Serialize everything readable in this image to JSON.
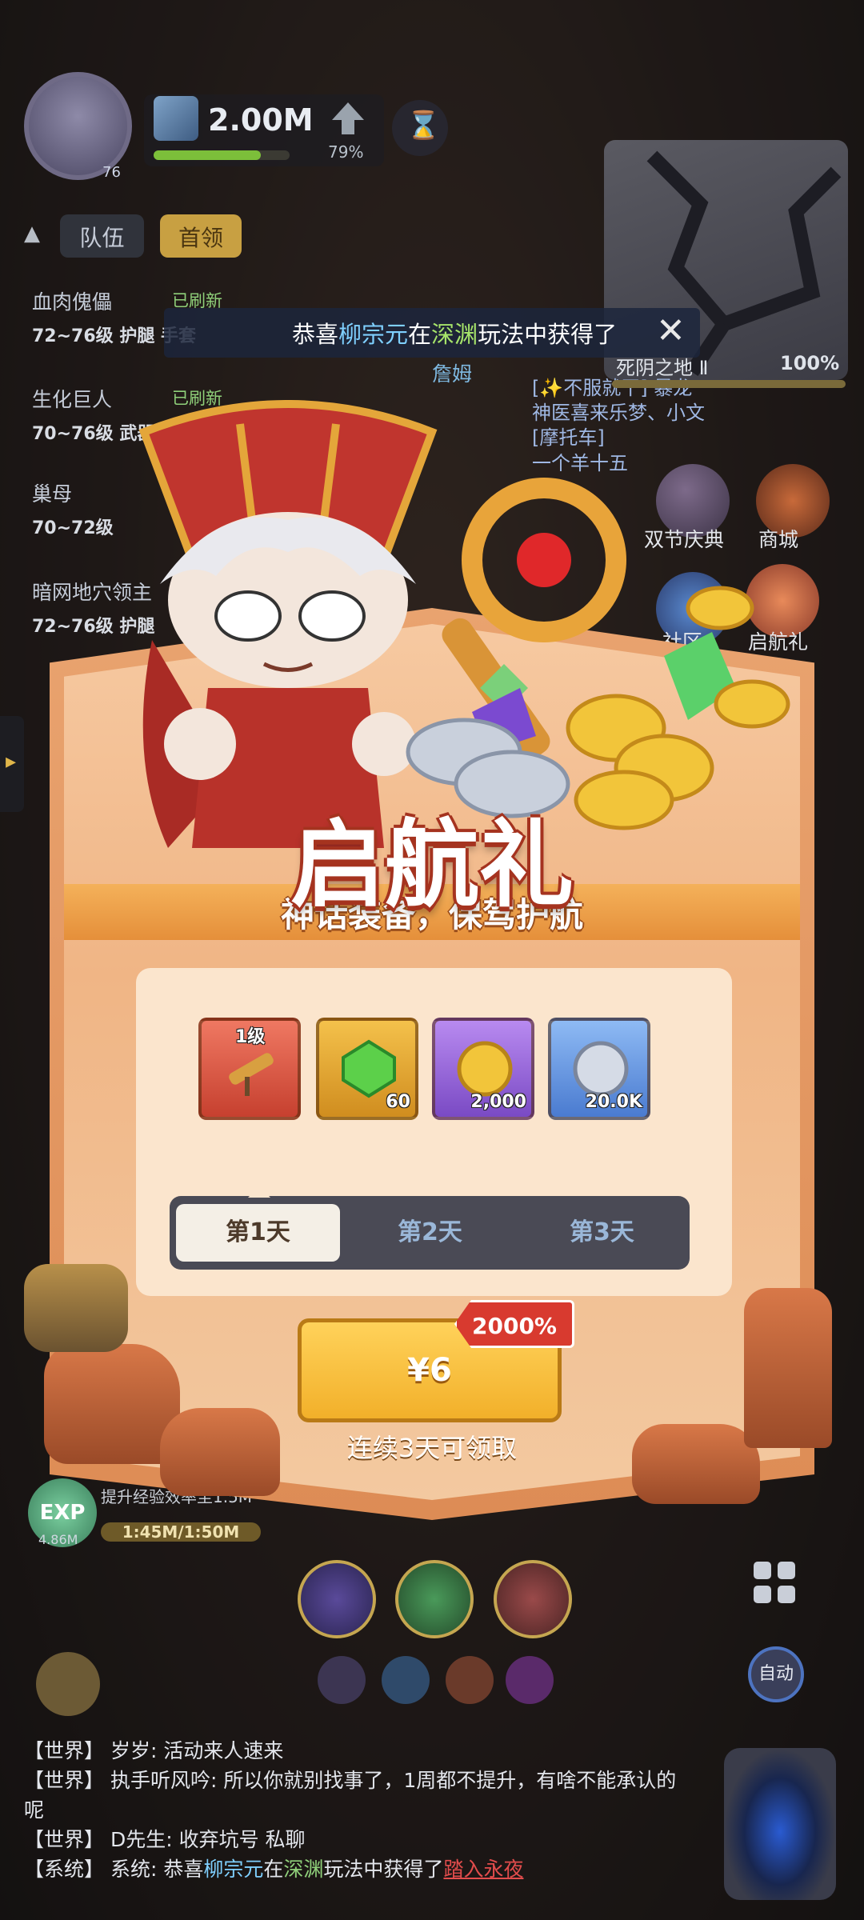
{
  "hud": {
    "power": "2.00M",
    "power_progress_pct": 79,
    "power_progress_label": "79%",
    "avatar_level": "76"
  },
  "minimap": {
    "zone_name": "死阴之地 Ⅱ",
    "progress": "100%"
  },
  "tabs": {
    "team": "队伍",
    "boss": "首领"
  },
  "bosses": [
    {
      "name": "血肉傀儡",
      "status": "已刷新",
      "detail": "72~76级  护腿  手套"
    },
    {
      "name": "生化巨人",
      "status": "已刷新",
      "detail": "70~76级  武器  披风"
    },
    {
      "name": "巢母",
      "status": "",
      "detail": "70~72级"
    },
    {
      "name": "暗网地穴领主",
      "status": "",
      "detail": "72~76级  护腿"
    }
  ],
  "announcement": {
    "prefix": "恭喜",
    "player": "柳宗元",
    "mid": "在",
    "place": "深渊",
    "suffix": "玩法中获得了"
  },
  "floating_name": "詹姆",
  "chat_bubbles": [
    "[✨不服就干] 暴龙",
    "神医喜来乐梦、小文",
    "[摩托车]",
    "一个羊十五"
  ],
  "side_menu": {
    "festival": "双节庆典",
    "shop": "商城",
    "community": "社区",
    "launch_gift": "启航礼"
  },
  "modal": {
    "title": "启航礼",
    "subtitle": "神话装备，保驾护航",
    "items": [
      {
        "name": "telescope",
        "level": "1级",
        "qty": ""
      },
      {
        "name": "emerald",
        "level": "",
        "qty": "60"
      },
      {
        "name": "gold-coin",
        "level": "",
        "qty": "2,000"
      },
      {
        "name": "silver-coin",
        "level": "",
        "qty": "20.0K"
      }
    ],
    "days": [
      "第1天",
      "第2天",
      "第3天"
    ],
    "selected_day": "第1天",
    "price": "¥6",
    "discount": "2000%",
    "hint": "连续3天可领取"
  },
  "exp": {
    "icon_label": "EXP",
    "amount": "4.86M",
    "text": "提升经验效率至1.5M",
    "bar": "1:45M/1:50M"
  },
  "auto_label": "自动",
  "chat_log": [
    {
      "channel": "【世界】",
      "speaker": "岁岁:",
      "text": "活动来人速来"
    },
    {
      "channel": "【世界】",
      "speaker": "执手听风吟:",
      "text": "所以你就别找事了，1周都不提升，有啥不能承认的呢"
    },
    {
      "channel": "【世界】",
      "speaker": "D先生:",
      "text": "收弃坑号 私聊"
    }
  ],
  "system_log": {
    "channel": "【系统】",
    "speaker": "系统:",
    "prefix": "恭喜",
    "player": "柳宗元",
    "mid": "在",
    "place": "深渊",
    "suffix": "玩法中获得了",
    "item": "踏入永夜"
  },
  "colors": {
    "accent_gold": "#f2b02a",
    "discount_red": "#d83a2f",
    "title_stroke": "#a5331f"
  }
}
